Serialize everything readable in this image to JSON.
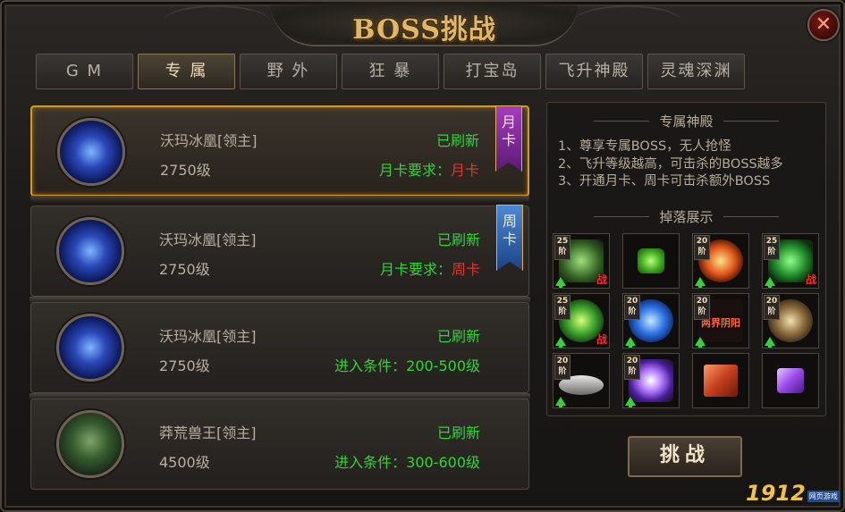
{
  "window": {
    "title": "BOSS挑战",
    "close_symbol": "✕"
  },
  "tabs": [
    {
      "label": "G M",
      "active": false
    },
    {
      "label": "专 属",
      "active": true
    },
    {
      "label": "野 外",
      "active": false
    },
    {
      "label": "狂 暴",
      "active": false
    },
    {
      "label": "打宝岛",
      "active": false
    },
    {
      "label": "飞升神殿",
      "active": false
    },
    {
      "label": "灵魂深渊",
      "active": false
    }
  ],
  "bosses": [
    {
      "name": "沃玛冰凰[领主]",
      "level": "2750级",
      "status": "已刷新",
      "req_label": "月卡要求：",
      "req_value": "月卡",
      "ribbon": "月卡",
      "portrait": "ice-phoenix-icon",
      "selected": true
    },
    {
      "name": "沃玛冰凰[领主]",
      "level": "2750级",
      "status": "已刷新",
      "req_label": "月卡要求：",
      "req_value": "周卡",
      "ribbon": "周卡",
      "portrait": "ice-phoenix-icon",
      "selected": false
    },
    {
      "name": "沃玛冰凰[领主]",
      "level": "2750级",
      "status": "已刷新",
      "req_label": "进入条件：200-500级",
      "req_value": "",
      "ribbon": "",
      "portrait": "ice-phoenix-icon",
      "selected": false
    },
    {
      "name": "莽荒兽王[领主]",
      "level": "4500级",
      "status": "已刷新",
      "req_label": "进入条件：300-600级",
      "req_value": "",
      "ribbon": "",
      "portrait": "beast-king-icon",
      "selected": false
    }
  ],
  "info": {
    "title": "专属神殿",
    "rules": [
      "1、尊享专属BOSS，无人抢怪",
      "2、飞升等级越高，可击杀的BOSS越多",
      "3、开通月卡、周卡可击杀额外BOSS"
    ],
    "drops_title": "掉落展示"
  },
  "drops": [
    {
      "icon": "armor-icon",
      "tier": "25阶",
      "up": true,
      "zhan": "战",
      "text": ""
    },
    {
      "icon": "green-gem-icon",
      "tier": "",
      "up": false,
      "zhan": "",
      "text": ""
    },
    {
      "icon": "fire-ring-icon",
      "tier": "20阶",
      "up": true,
      "zhan": "",
      "text": ""
    },
    {
      "icon": "green-bow-icon",
      "tier": "25阶",
      "up": true,
      "zhan": "战",
      "text": ""
    },
    {
      "icon": "green-ring-icon",
      "tier": "25阶",
      "up": true,
      "zhan": "战",
      "text": ""
    },
    {
      "icon": "blue-orb-icon",
      "tier": "20阶",
      "up": true,
      "zhan": "",
      "text": ""
    },
    {
      "icon": "yin-yang-title-icon",
      "tier": "20阶",
      "up": true,
      "zhan": "",
      "text": "两界阴阳"
    },
    {
      "icon": "beast-mask-icon",
      "tier": "20阶",
      "up": true,
      "zhan": "",
      "text": ""
    },
    {
      "icon": "dish-icon",
      "tier": "20阶",
      "up": true,
      "zhan": "",
      "text": ""
    },
    {
      "icon": "purple-wings-icon",
      "tier": "20阶",
      "up": true,
      "zhan": "",
      "text": ""
    },
    {
      "icon": "gift-box-icon",
      "tier": "",
      "up": false,
      "zhan": "",
      "text": ""
    },
    {
      "icon": "purple-crystal-icon",
      "tier": "",
      "up": false,
      "zhan": "",
      "text": ""
    }
  ],
  "challenge_label": "挑战",
  "watermark": {
    "number": "1912",
    "sub": "网页游戏"
  },
  "colors": {
    "accent": "#d19a2c",
    "status_green": "#33d439",
    "req_red": "#e0362c"
  }
}
